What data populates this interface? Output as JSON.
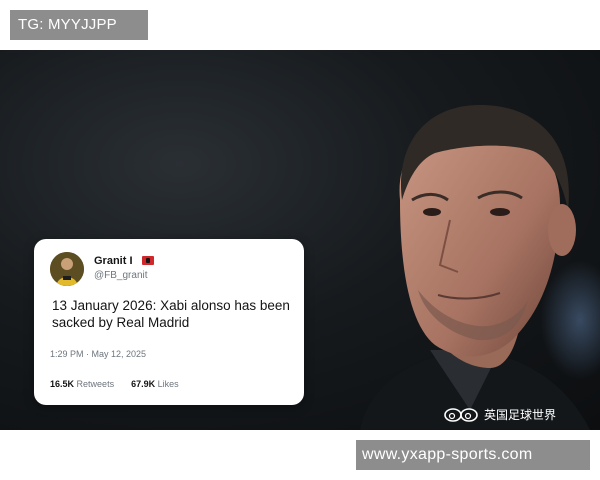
{
  "top_label": {
    "text": "TG: MYYJJPP"
  },
  "tweet": {
    "display_name": "Granit I",
    "handle": "@FB_granit",
    "text": " 13 January 2026: Xabi alonso has been sacked by Real Madrid",
    "timestamp": "1:29 PM · May 12, 2025",
    "retweets_count": "16.5K",
    "retweets_label": "Retweets",
    "likes_count": "67.9K",
    "likes_label": "Likes",
    "flag_icon": "albania-flag-icon",
    "avatar_icon": "avatar"
  },
  "watermark": {
    "text": "英国足球世界"
  },
  "bottom_label": {
    "text": "www.yxapp-sports.com"
  }
}
